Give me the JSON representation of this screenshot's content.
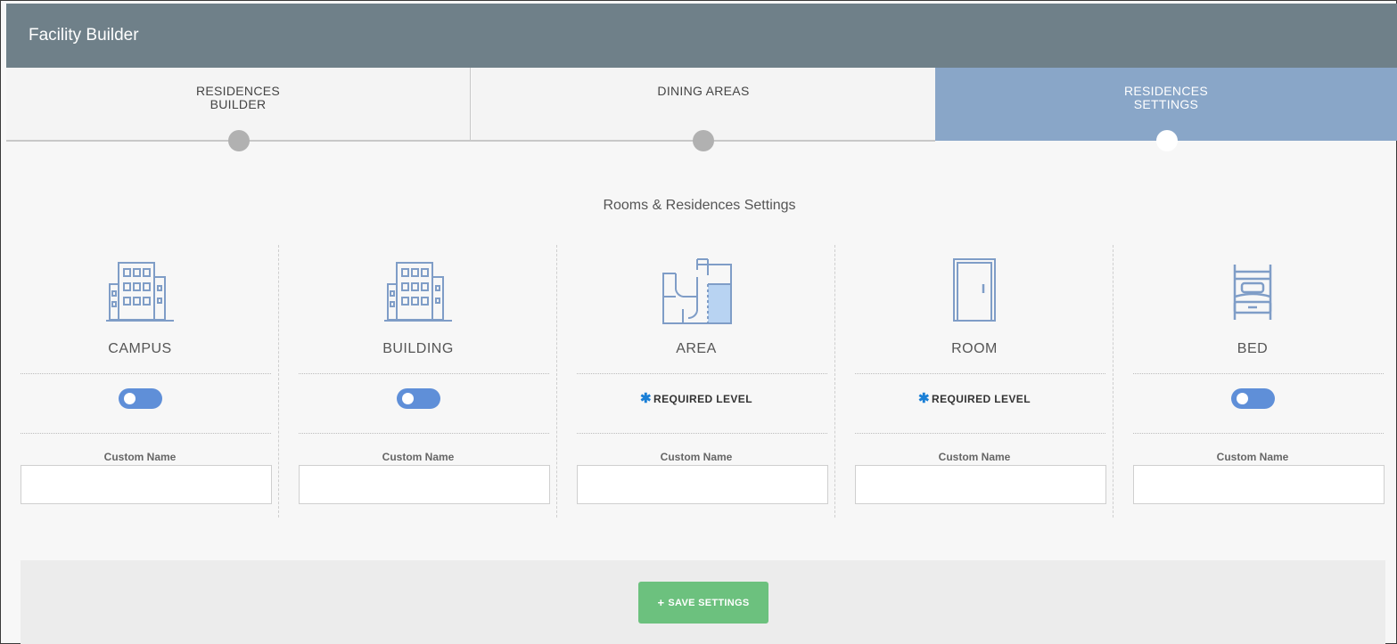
{
  "header": {
    "title": "Facility Builder"
  },
  "tabs": [
    {
      "label": "RESIDENCES\nBUILDER",
      "active": false
    },
    {
      "label": "DINING AREAS",
      "active": false
    },
    {
      "label": "RESIDENCES\nSETTINGS",
      "active": true
    }
  ],
  "section_title": "Rooms & Residences Settings",
  "levels": [
    {
      "name": "CAMPUS",
      "icon": "building-icon",
      "control": "toggle",
      "custom_name_label": "Custom Name",
      "custom_name_value": ""
    },
    {
      "name": "BUILDING",
      "icon": "building-icon",
      "control": "toggle",
      "custom_name_label": "Custom Name",
      "custom_name_value": ""
    },
    {
      "name": "AREA",
      "icon": "floor-plan-icon",
      "control": "required",
      "required_text": "REQUIRED LEVEL",
      "custom_name_label": "Custom Name",
      "custom_name_value": ""
    },
    {
      "name": "ROOM",
      "icon": "door-icon",
      "control": "required",
      "required_text": "REQUIRED LEVEL",
      "custom_name_label": "Custom Name",
      "custom_name_value": ""
    },
    {
      "name": "BED",
      "icon": "bed-icon",
      "control": "toggle",
      "custom_name_label": "Custom Name",
      "custom_name_value": ""
    }
  ],
  "footer": {
    "save_label": "SAVE SETTINGS",
    "save_icon": "plus-icon"
  },
  "colors": {
    "header_bg": "#6f8089",
    "active_tab_bg": "#89a6c8",
    "toggle": "#5f8fd8",
    "icon_stroke": "#7f9dc7",
    "required_star": "#1a7fd6",
    "save_button": "#6cc17e"
  }
}
